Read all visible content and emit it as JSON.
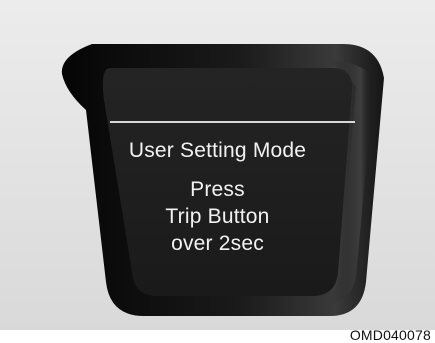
{
  "display": {
    "mode_title": "User Setting Mode",
    "instruction_lines": [
      "Press",
      "Trip Button",
      "over 2sec"
    ]
  },
  "figure_id": "OMD040078",
  "colors": {
    "background": "#e6e6e6",
    "display_bezel": "#0e0e0e",
    "display_screen": "#1e1e1e",
    "text": "#f2f2f2",
    "divider": "#d8d8d8"
  }
}
